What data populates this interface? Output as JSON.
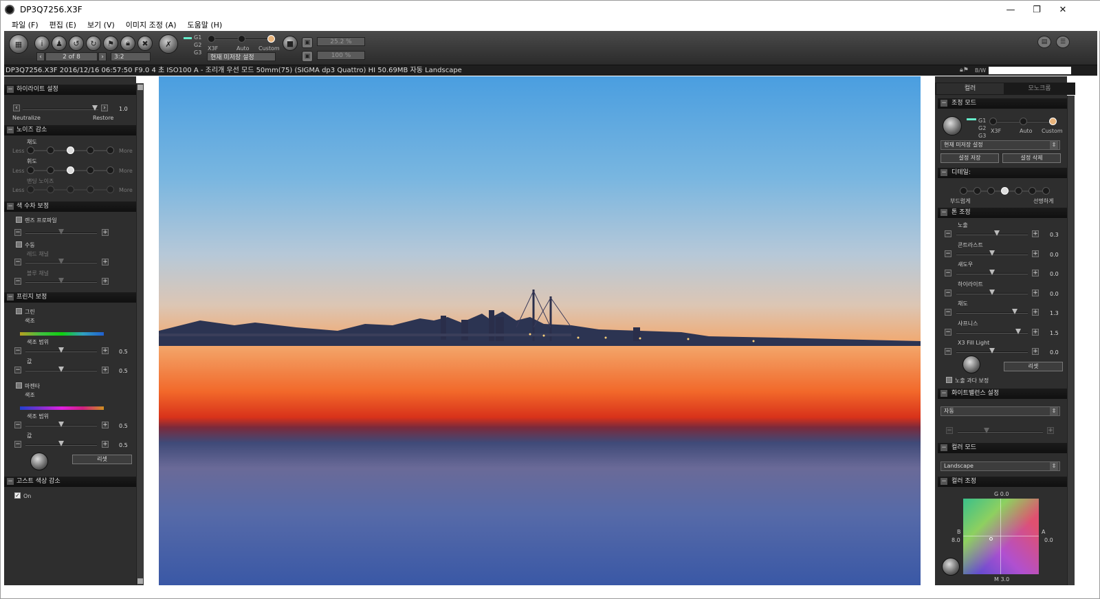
{
  "window": {
    "title": "DP3Q7256.X3F",
    "controls": [
      "—",
      "❐",
      "✕"
    ]
  },
  "menu": [
    "파일 (F)",
    "편집 (E)",
    "보기 (V)",
    "이미지 조정 (A)",
    "도움말 (H)"
  ],
  "toolbar": {
    "page": "2 of 8",
    "ratio": "3:2",
    "g_labels": [
      "G1",
      "G2",
      "G3"
    ],
    "mode_labels": [
      "X3F",
      "Auto",
      "Custom"
    ],
    "preset": "현재 미저장 설정",
    "zoom1": "25.2 %",
    "zoom2": "100 %"
  },
  "infobar": {
    "text": "DP3Q7256.X3F 2016/12/16 06:57:50 F9.0 4 초 ISO100 A - 조리개 우선 모드 50mm(75) (SIGMA dp3 Quattro) HI 50.69MB 자동 Landscape",
    "bw": "B/W"
  },
  "left": {
    "highlight": {
      "title": "하이라이트 설정",
      "value": "1.0",
      "neutralize": "Neutralize",
      "restore": "Restore"
    },
    "noise": {
      "title": "노이즈 감소",
      "chroma": "채도",
      "luma": "휘도",
      "banding": "밴딩 노이즈",
      "less": "Less",
      "more": "More"
    },
    "aberration": {
      "title": "색 수차 보정",
      "lens_profile": "렌즈 프로파일",
      "manual": "수동",
      "red_ch": "레드 채널",
      "blue_ch": "블루 채널"
    },
    "fringe": {
      "title": "프린지 보정",
      "green": "그린",
      "hue": "색조",
      "hue_range": "색조 범위",
      "amount": "값",
      "magenta": "마젠타",
      "vals": [
        "0.5",
        "0.5",
        "0.5",
        "0.5"
      ],
      "reset": "리셋"
    },
    "ghost": {
      "title": "고스트 색상 감소",
      "on": "On"
    }
  },
  "right": {
    "tabs": [
      "컬러",
      "모노크롬"
    ],
    "adjust_mode": {
      "title": "조정 모드",
      "preset": "현재 미저장 설정",
      "save": "설정 저장",
      "delete": "설정 삭제"
    },
    "detail": {
      "title": "디테일:",
      "soft": "부드럽게",
      "sharp": "선명하게"
    },
    "tone": {
      "title": "톤 조정",
      "rows": [
        {
          "label": "노출",
          "value": "0.3"
        },
        {
          "label": "콘트라스트",
          "value": "0.0"
        },
        {
          "label": "섀도우",
          "value": "0.0"
        },
        {
          "label": "하이라이트",
          "value": "0.0"
        },
        {
          "label": "채도",
          "value": "1.3"
        },
        {
          "label": "샤프니스",
          "value": "1.5"
        },
        {
          "label": "X3 Fill Light",
          "value": "0.0"
        }
      ],
      "reset": "리셋",
      "overexposure": "노출 과다 보정"
    },
    "wb": {
      "title": "화이트밸런스 설정",
      "value": "자동"
    },
    "color_mode": {
      "title": "컬러 모드",
      "value": "Landscape"
    },
    "color_adj": {
      "title": "컬러 조정",
      "g": "G 0.0",
      "b": "B",
      "b_val": "8.0",
      "a": "A",
      "a_val": "0.0",
      "m": "M 3.0"
    }
  }
}
